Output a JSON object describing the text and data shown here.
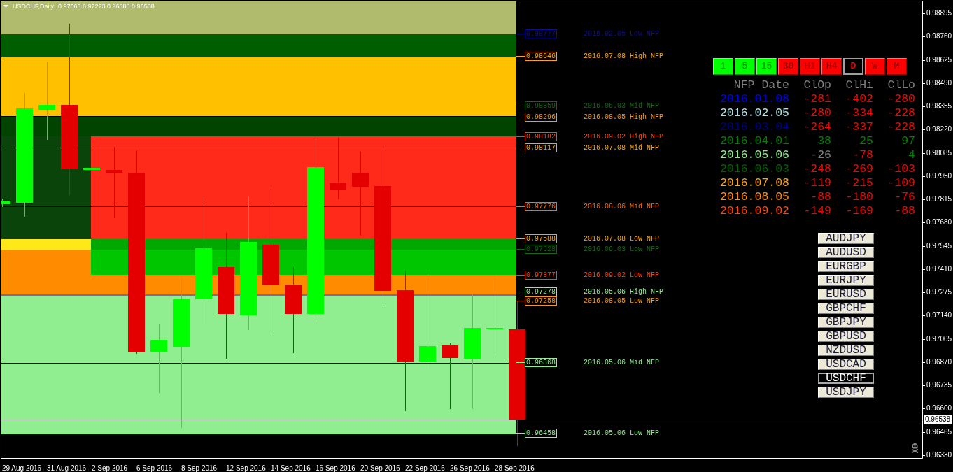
{
  "chart": {
    "title": "USDCHF,Daily",
    "quote": "0.97063 0.97223 0.96388 0.96538"
  },
  "levels": [
    {
      "price": "0.98777",
      "label": "2016.02.05 Low NFP",
      "color": "#10108c"
    },
    {
      "price": "0.98646",
      "label": "2016.07.08 High NFP",
      "color": "#ffa500"
    },
    {
      "price": "0.98359",
      "label": "2016.06.03 Mid NFP",
      "color": "#126812"
    },
    {
      "price": "0.98296",
      "label": "2016.08.05 High NFP",
      "color": "#ff9a00"
    },
    {
      "price": "0.98182",
      "label": "2016.09.02 High NFP",
      "color": "#ff4500"
    },
    {
      "price": "0.98117",
      "label": "2016.07.08 Mid NFP",
      "color": "#ffa500"
    },
    {
      "price": "0.97776",
      "label": "2016.08.06 Mid NFP",
      "color": "#ff6a00"
    },
    {
      "price": "0.97588",
      "label": "2016.07.08 Low NFP",
      "color": "#ffa500"
    },
    {
      "price": "0.97528",
      "label": "2016.06.03 Low NFP",
      "color": "#126812"
    },
    {
      "price": "0.97377",
      "label": "2016.09.02 Low NFP",
      "color": "#ff4500"
    },
    {
      "price": "0.97278",
      "label": "2016.05.06 High NFP",
      "color": "#90ee90"
    },
    {
      "price": "0.97258",
      "label": "2016.08.05 Low NFP",
      "color": "#ff9a00"
    },
    {
      "price": "0.96868",
      "label": "2016.05.06 Mid NFP",
      "color": "#90ee90"
    },
    {
      "price": "0.96458",
      "label": "2016.05.06 Low NFP",
      "color": "#90ee90"
    }
  ],
  "timeframes": [
    {
      "label": "1",
      "color": "#00ff00",
      "selected": false
    },
    {
      "label": "5",
      "color": "#00ff00",
      "selected": false
    },
    {
      "label": "15",
      "color": "#00ff00",
      "selected": false
    },
    {
      "label": "30",
      "color": "#ff0000",
      "selected": false
    },
    {
      "label": "H1",
      "color": "#ff0000",
      "selected": false
    },
    {
      "label": "H4",
      "color": "#ff0000",
      "selected": false
    },
    {
      "label": "D",
      "color": "#ff0000",
      "selected": true
    },
    {
      "label": "W",
      "color": "#ff0000",
      "selected": false
    },
    {
      "label": "M",
      "color": "#ff0000",
      "selected": false
    }
  ],
  "nfp_table": {
    "columns": [
      "NFP Date",
      "ClOp",
      "ClHi",
      "ClLo"
    ],
    "rows": [
      {
        "date": "2016.01.08",
        "color": "#0000ff",
        "values": [
          {
            "text": "-281",
            "color": "#ff0000"
          },
          {
            "text": "-402",
            "color": "#ff0000"
          },
          {
            "text": "-280",
            "color": "#ff0000"
          }
        ]
      },
      {
        "date": "2016.02.05",
        "color": "#b0e0e6",
        "values": [
          {
            "text": "-280",
            "color": "#ff0000"
          },
          {
            "text": "-334",
            "color": "#ff0000"
          },
          {
            "text": "-228",
            "color": "#ff0000"
          }
        ]
      },
      {
        "date": "2016.03.04",
        "color": "#000080",
        "values": [
          {
            "text": "-264",
            "color": "#ff0000"
          },
          {
            "text": "-337",
            "color": "#ff0000"
          },
          {
            "text": "-228",
            "color": "#ff0000"
          }
        ]
      },
      {
        "date": "2016.04.01",
        "color": "#008000",
        "values": [
          {
            "text": "38",
            "color": "#008000"
          },
          {
            "text": "25",
            "color": "#008000"
          },
          {
            "text": "97",
            "color": "#008000"
          }
        ]
      },
      {
        "date": "2016.05.06",
        "color": "#90ee90",
        "values": [
          {
            "text": "-26",
            "color": "#808080"
          },
          {
            "text": "-78",
            "color": "#ff0000"
          },
          {
            "text": "4",
            "color": "#008000"
          }
        ]
      },
      {
        "date": "2016.06.03",
        "color": "#006400",
        "values": [
          {
            "text": "-248",
            "color": "#ff0000"
          },
          {
            "text": "-269",
            "color": "#ff0000"
          },
          {
            "text": "-103",
            "color": "#ff0000"
          }
        ]
      },
      {
        "date": "2016.07.08",
        "color": "#ffa500",
        "values": [
          {
            "text": "-119",
            "color": "#ff0000"
          },
          {
            "text": "-215",
            "color": "#ff0000"
          },
          {
            "text": "-109",
            "color": "#ff0000"
          }
        ]
      },
      {
        "date": "2016.08.05",
        "color": "#ff8c00",
        "values": [
          {
            "text": "-88",
            "color": "#ff0000"
          },
          {
            "text": "-180",
            "color": "#ff0000"
          },
          {
            "text": "-76",
            "color": "#ff0000"
          }
        ]
      },
      {
        "date": "2016.09.02",
        "color": "#ff4500",
        "values": [
          {
            "text": "-149",
            "color": "#ff0000"
          },
          {
            "text": "-169",
            "color": "#ff0000"
          },
          {
            "text": "-88",
            "color": "#ff0000"
          }
        ]
      }
    ]
  },
  "symbols": [
    {
      "label": "AUDJPY",
      "selected": false
    },
    {
      "label": "AUDUSD",
      "selected": false
    },
    {
      "label": "EURGBP",
      "selected": false
    },
    {
      "label": "EURJPY",
      "selected": false
    },
    {
      "label": "EURUSD",
      "selected": false
    },
    {
      "label": "GBPCHF",
      "selected": false
    },
    {
      "label": "GBPJPY",
      "selected": false
    },
    {
      "label": "GBPUSD",
      "selected": false
    },
    {
      "label": "NZDUSD",
      "selected": false
    },
    {
      "label": "USDCAD",
      "selected": false
    },
    {
      "label": "USDCHF",
      "selected": true
    },
    {
      "label": "USDJPY",
      "selected": false
    }
  ],
  "price_axis": {
    "ticks": [
      "0.98895",
      "0.98760",
      "0.98625",
      "0.98490",
      "0.98355",
      "0.98220",
      "0.98085",
      "0.97950",
      "0.97815",
      "0.97680",
      "0.97545",
      "0.97410",
      "0.97275",
      "0.97140",
      "0.97005",
      "0.96870",
      "0.96735",
      "0.96600",
      "0.96465",
      "0.96330"
    ],
    "current_price": "0.96538"
  },
  "date_axis": {
    "labels": [
      "29 Aug 2016",
      "31 Aug 2016",
      "2 Sep 2016",
      "6 Sep 2016",
      "8 Sep 2016",
      "12 Sep 2016",
      "14 Sep 2016",
      "16 Sep 2016",
      "20 Sep 2016",
      "22 Sep 2016",
      "26 Sep 2016",
      "28 Sep 2016"
    ]
  }
}
